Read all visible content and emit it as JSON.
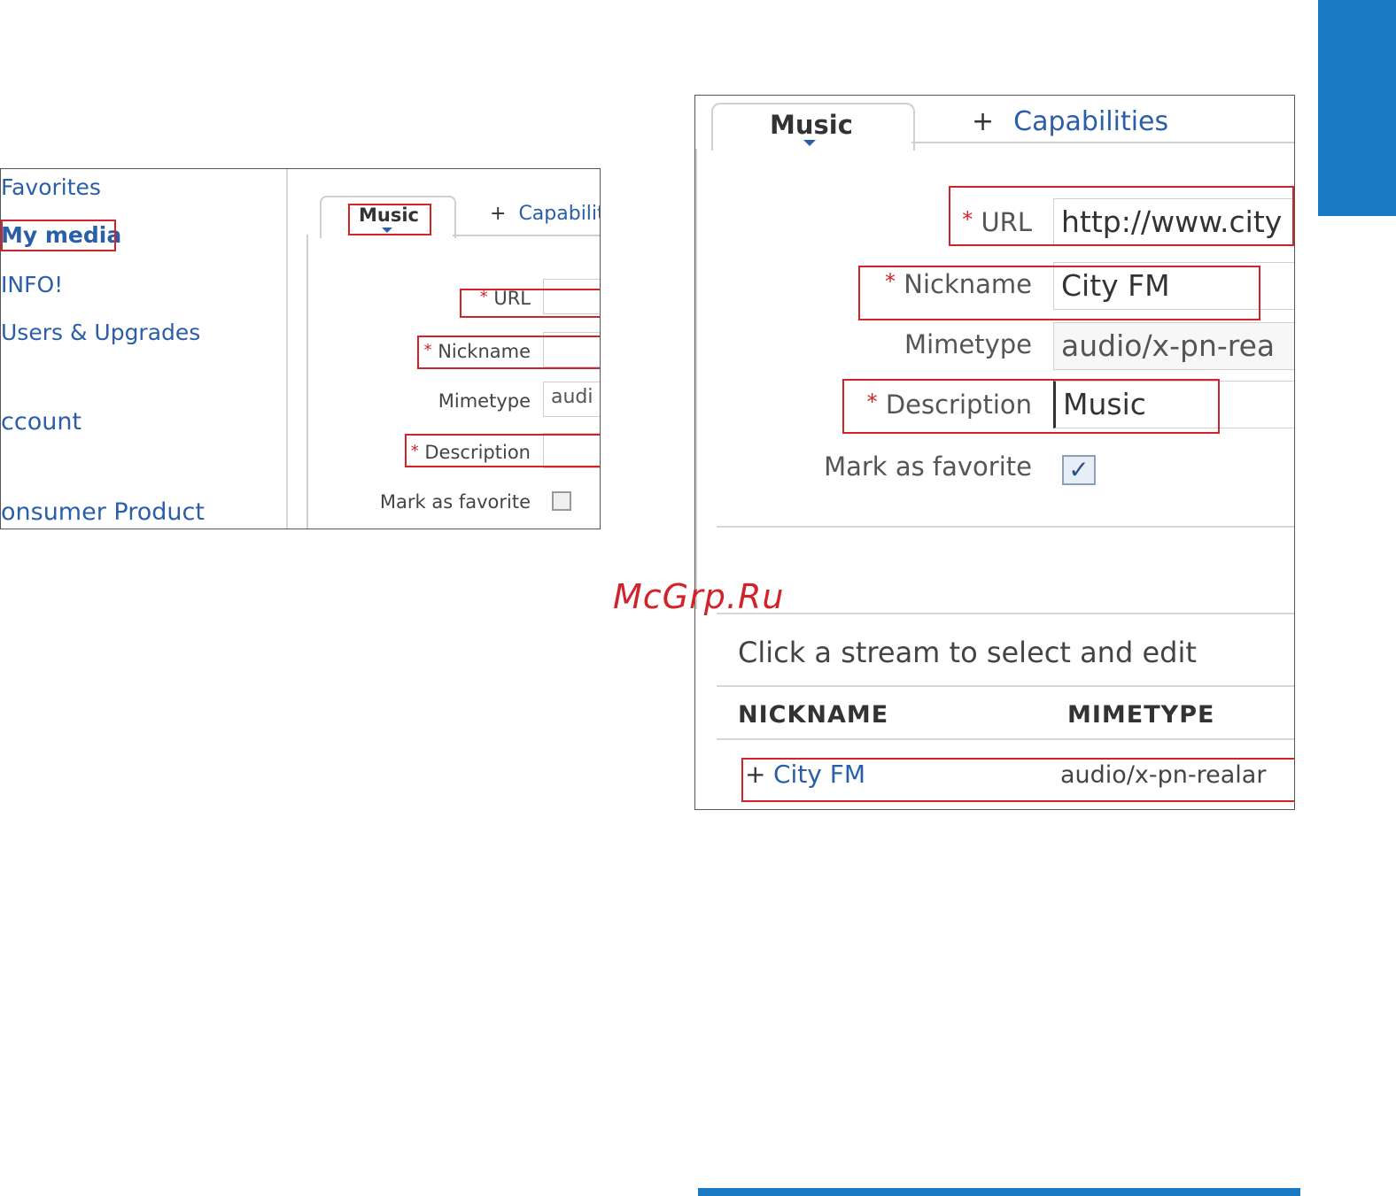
{
  "left_screenshot": {
    "nav": {
      "favorites": "Favorites",
      "my_media": "My media",
      "info": "INFO!",
      "users_upgrades": "Users & Upgrades",
      "account": "ccount",
      "consumer_product": "onsumer Product"
    },
    "tabs": {
      "music": "Music",
      "plus": "+",
      "capabilities": "Capabilit"
    },
    "form": {
      "required_marker": "*",
      "url_label": "URL",
      "nickname_label": "Nickname",
      "mimetype_label": "Mimetype",
      "mimetype_value": "audi",
      "description_label": "Description",
      "favorite_label": "Mark as favorite"
    }
  },
  "right_screenshot": {
    "tabs": {
      "music": "Music",
      "plus": "+",
      "capabilities": "Capabilities"
    },
    "form": {
      "required_marker": "*",
      "url_label": "URL",
      "url_value": "http://www.city",
      "nickname_label": "Nickname",
      "nickname_value": "City FM",
      "mimetype_label": "Mimetype",
      "mimetype_value": "audio/x-pn-rea",
      "description_label": "Description",
      "description_value": "Music",
      "favorite_label": "Mark as favorite",
      "favorite_check": "✓"
    },
    "stream_list": {
      "instruction": "Click a stream to select and edit",
      "columns": [
        "NICKNAME",
        "MIMETYPE"
      ],
      "rows": [
        {
          "expander": "+",
          "nickname": "City FM",
          "mimetype": "audio/x-pn-realar"
        }
      ]
    }
  },
  "watermark": "McGrp.Ru",
  "colors": {
    "accent_blue": "#1a7bc4",
    "link_blue": "#2a5ea8",
    "highlight_red": "#d2232a"
  }
}
